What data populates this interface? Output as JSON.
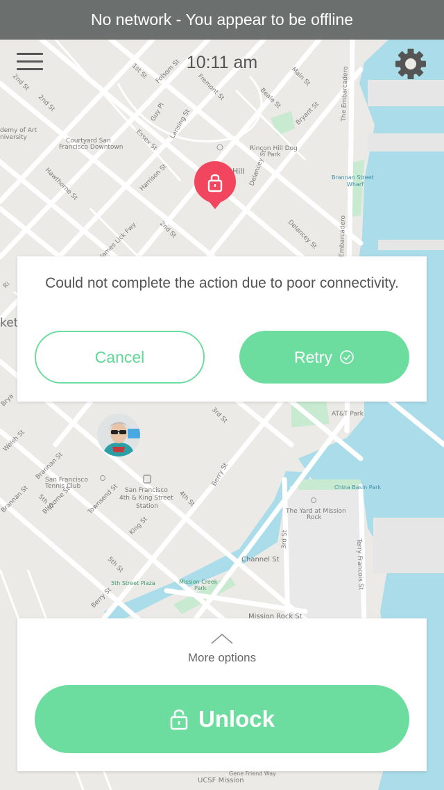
{
  "status_banner": {
    "text": "No network - You appear to be offline"
  },
  "header": {
    "time": "10:11 am",
    "menu_icon": "hamburger-menu-icon",
    "settings_icon": "gear-icon"
  },
  "map": {
    "streets": [
      "1st St",
      "2nd St",
      "2nd St",
      "Folsom St",
      "Fremont St",
      "Main St",
      "Beale St",
      "Bryant St",
      "The Embarcadero",
      "Guy Pl",
      "Lansing St",
      "Essex St",
      "Harrison St",
      "Hawthorne St",
      "Delancey St",
      "James Lick Fwy",
      "Brannan St",
      "Brannan St",
      "Welsh St",
      "5th St",
      "Bluxome St",
      "Townsend St",
      "King St",
      "4th St",
      "Berry St",
      "3rd St",
      "Channel St",
      "Mission Rock St",
      "Terry Francois St",
      "Berry St",
      "5th St"
    ],
    "places": [
      "Courtyard San Francisco Downtown",
      "Rincon Hill Dog Park",
      "Brannan Street Wharf",
      "San Francisco Tennis Club",
      "San Francisco 4th & King Street Station",
      "China Basin Park",
      "The Yard at Mission Rock",
      "Mission Creek Park",
      "5th Street Plaza",
      "AT&T Park",
      "UCSF Mission Bay"
    ],
    "partial_labels": [
      "Academy of Art University",
      "Hill",
      "Ri",
      "ket",
      "Brya",
      "Gene Friend Way"
    ]
  },
  "dialog": {
    "message": "Could not complete the action due to poor connectivity.",
    "cancel_label": "Cancel",
    "retry_label": "Retry"
  },
  "bottom_panel": {
    "more_options_label": "More options",
    "unlock_label": "Unlock"
  },
  "colors": {
    "accent": "#6ddd9f",
    "pin": "#f2465e",
    "water": "#aadcea",
    "park": "#c8ead0"
  }
}
